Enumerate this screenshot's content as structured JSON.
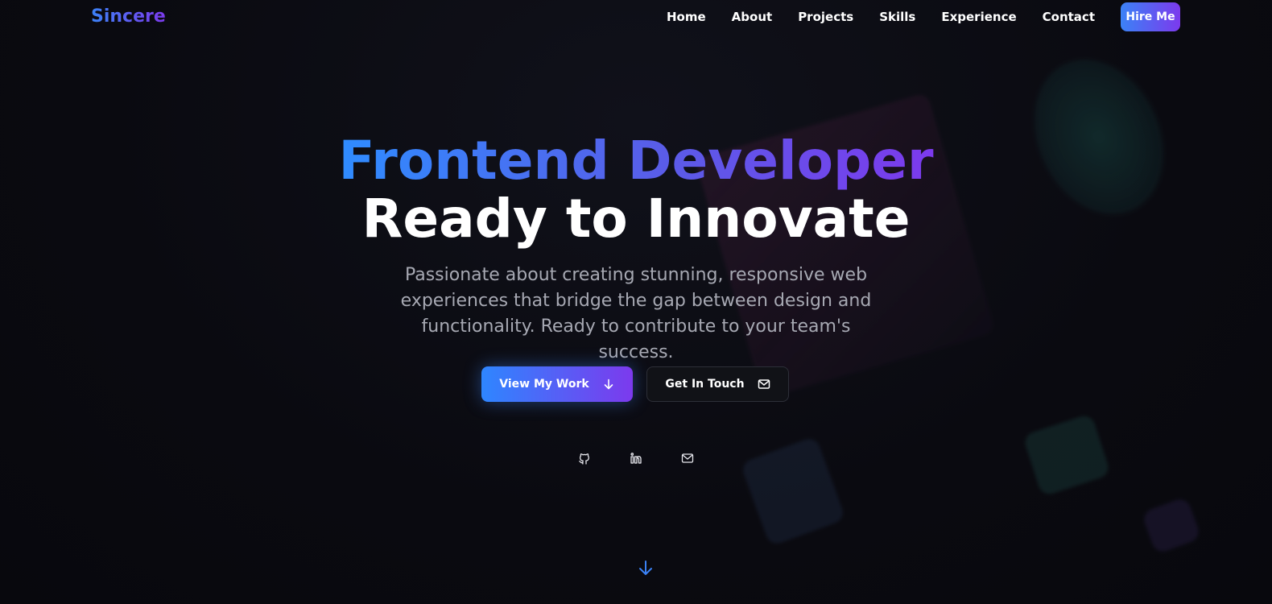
{
  "header": {
    "logo": "Sincere",
    "nav": [
      "Home",
      "About",
      "Projects",
      "Skills",
      "Experience",
      "Contact"
    ],
    "cta": "Hire Me"
  },
  "hero": {
    "title_line1": "Frontend Developer",
    "title_line2": "Ready to Innovate",
    "subtitle": "Passionate about creating stunning, responsive web experiences that bridge the gap between design and functionality. Ready to contribute to your team's success.",
    "primary_button": "View My Work",
    "secondary_button": "Get In Touch"
  },
  "socials": {
    "icons": [
      "github-icon",
      "linkedin-icon",
      "mail-icon"
    ]
  },
  "colors": {
    "background": "#0a0a10",
    "accent_start": "#3b82f6",
    "accent_end": "#7c3aed",
    "subtitle_text": "#a7a9b3"
  }
}
